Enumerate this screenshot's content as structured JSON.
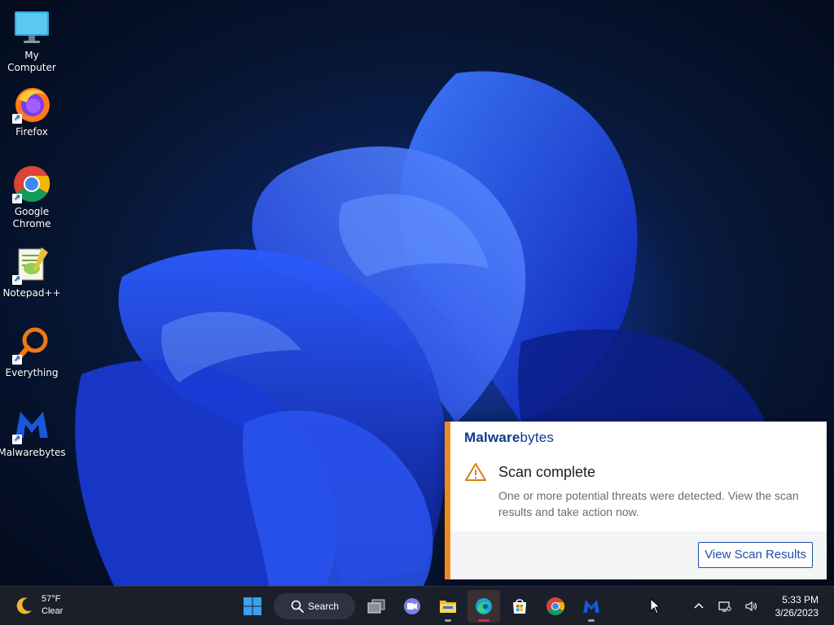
{
  "desktop": {
    "icons": [
      {
        "label": "My Computer",
        "icon": "monitor-icon"
      },
      {
        "label": "Firefox",
        "icon": "firefox-icon"
      },
      {
        "label": "Google Chrome",
        "icon": "chrome-icon"
      },
      {
        "label": "Notepad++",
        "icon": "notepadpp-icon"
      },
      {
        "label": "Everything",
        "icon": "everything-search-icon"
      },
      {
        "label": "Malwarebytes",
        "icon": "malwarebytes-icon"
      }
    ]
  },
  "notification": {
    "brand_bold": "Malware",
    "brand_thin": "bytes",
    "title": "Scan complete",
    "message": "One or more potential threats were detected. View the scan results and take action now.",
    "action_label": "View Scan Results",
    "accent_color": "#f08a1c"
  },
  "taskbar": {
    "weather": {
      "temp": "57°F",
      "condition": "Clear",
      "icon": "moon-icon"
    },
    "search_label": "Search",
    "apps": [
      "start-icon",
      "task-view-icon",
      "teams-chat-icon",
      "file-explorer-icon",
      "edge-icon",
      "store-icon",
      "chrome-icon",
      "malwarebytes-icon"
    ],
    "tray": {
      "time": "5:33 PM",
      "date": "3/26/2023"
    }
  }
}
